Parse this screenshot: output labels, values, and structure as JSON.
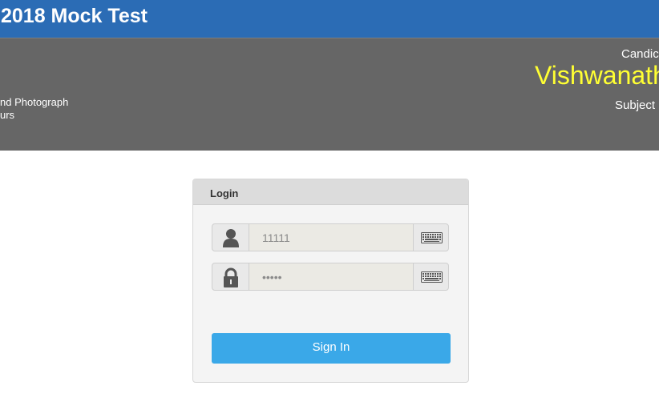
{
  "header": {
    "title": "2018 Mock Test"
  },
  "info": {
    "left_line1": "nd Photograph",
    "left_line2": "urs",
    "candidate_label": "Candic",
    "candidate_name": "Vishwanath",
    "subject_label": "Subject"
  },
  "login": {
    "panel_title": "Login",
    "username_value": "11111",
    "password_value": "•••••",
    "signin_label": "Sign In"
  },
  "icons": {
    "user": "user-icon",
    "lock": "lock-icon",
    "keyboard": "keyboard-icon"
  },
  "colors": {
    "header_bg": "#2b6cb5",
    "info_bg": "#666666",
    "candidate_name": "#ffff33",
    "signin_bg": "#3aa8e8"
  }
}
